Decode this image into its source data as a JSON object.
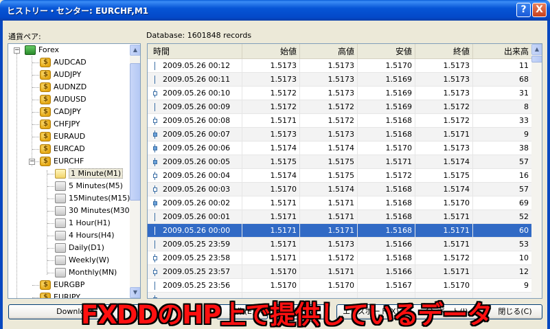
{
  "window": {
    "title": "ヒストリー・センター: EURCHF,M1",
    "help_label": "?",
    "close_label": "X"
  },
  "labels": {
    "currency_pair": "通貨ペア:",
    "database": "Database: 1601848 records"
  },
  "tree": {
    "root": "Forex",
    "pairs": [
      "AUDCAD",
      "AUDJPY",
      "AUDNZD",
      "AUDUSD",
      "CADJPY",
      "CHFJPY",
      "EURAUD",
      "EURCAD",
      "EURCHF"
    ],
    "timeframes": [
      "1 Minute(M1)",
      "5 Minutes(M5)",
      "15Minutes(M15)",
      "30 Minutes(M30)",
      "1 Hour(H1)",
      "4 Hours(H4)",
      "Daily(D1)",
      "Weekly(W)",
      "Monthly(MN)"
    ],
    "after": [
      "EURGBP",
      "EURJPY"
    ],
    "selected": "1 Minute(M1)"
  },
  "grid": {
    "columns": [
      "時間",
      "始値",
      "高値",
      "安値",
      "終値",
      "出来高"
    ],
    "rows": [
      {
        "time": "2009.05.26 00:12",
        "open": "1.5173",
        "high": "1.5173",
        "low": "1.5170",
        "close": "1.5173",
        "vol": "11",
        "candle": "doji"
      },
      {
        "time": "2009.05.26 00:11",
        "open": "1.5173",
        "high": "1.5173",
        "low": "1.5169",
        "close": "1.5173",
        "vol": "68",
        "candle": "doji"
      },
      {
        "time": "2009.05.26 00:10",
        "open": "1.5172",
        "high": "1.5173",
        "low": "1.5169",
        "close": "1.5173",
        "vol": "31",
        "candle": "hollow"
      },
      {
        "time": "2009.05.26 00:09",
        "open": "1.5172",
        "high": "1.5172",
        "low": "1.5169",
        "close": "1.5172",
        "vol": "8",
        "candle": "doji"
      },
      {
        "time": "2009.05.26 00:08",
        "open": "1.5171",
        "high": "1.5172",
        "low": "1.5168",
        "close": "1.5172",
        "vol": "33",
        "candle": "hollow"
      },
      {
        "time": "2009.05.26 00:07",
        "open": "1.5173",
        "high": "1.5173",
        "low": "1.5168",
        "close": "1.5171",
        "vol": "9",
        "candle": "filled"
      },
      {
        "time": "2009.05.26 00:06",
        "open": "1.5174",
        "high": "1.5174",
        "low": "1.5170",
        "close": "1.5173",
        "vol": "38",
        "candle": "filled"
      },
      {
        "time": "2009.05.26 00:05",
        "open": "1.5175",
        "high": "1.5175",
        "low": "1.5171",
        "close": "1.5174",
        "vol": "57",
        "candle": "filled"
      },
      {
        "time": "2009.05.26 00:04",
        "open": "1.5174",
        "high": "1.5175",
        "low": "1.5172",
        "close": "1.5175",
        "vol": "16",
        "candle": "hollow"
      },
      {
        "time": "2009.05.26 00:03",
        "open": "1.5170",
        "high": "1.5174",
        "low": "1.5168",
        "close": "1.5174",
        "vol": "57",
        "candle": "hollow"
      },
      {
        "time": "2009.05.26 00:02",
        "open": "1.5171",
        "high": "1.5171",
        "low": "1.5168",
        "close": "1.5170",
        "vol": "69",
        "candle": "filled"
      },
      {
        "time": "2009.05.26 00:01",
        "open": "1.5171",
        "high": "1.5171",
        "low": "1.5168",
        "close": "1.5171",
        "vol": "52",
        "candle": "doji"
      },
      {
        "time": "2009.05.26 00:00",
        "open": "1.5171",
        "high": "1.5171",
        "low": "1.5168",
        "close": "1.5171",
        "vol": "60",
        "candle": "doji"
      },
      {
        "time": "2009.05.25 23:59",
        "open": "1.5171",
        "high": "1.5173",
        "low": "1.5166",
        "close": "1.5171",
        "vol": "53",
        "candle": "doji"
      },
      {
        "time": "2009.05.25 23:58",
        "open": "1.5171",
        "high": "1.5172",
        "low": "1.5168",
        "close": "1.5172",
        "vol": "10",
        "candle": "hollow"
      },
      {
        "time": "2009.05.25 23:57",
        "open": "1.5170",
        "high": "1.5171",
        "low": "1.5166",
        "close": "1.5171",
        "vol": "12",
        "candle": "hollow"
      },
      {
        "time": "2009.05.25 23:56",
        "open": "1.5170",
        "high": "1.5170",
        "low": "1.5167",
        "close": "1.5170",
        "vol": "9",
        "candle": "doji"
      },
      {
        "time": "",
        "open": "",
        "high": "",
        "low": "",
        "close": "",
        "vol": "",
        "candle": "filled"
      }
    ],
    "selected_index": 12
  },
  "buttons": {
    "download": "Download",
    "edit": "編集(E)",
    "delete": "削除(D)",
    "export": "エクスポート(X)",
    "import": "インポート(I)",
    "close": "閉じる(C)"
  },
  "overlay_caption": "FXDDのHP上で提供しているデータ",
  "colors": {
    "title_bar": "#0655d6",
    "selection": "#316ac5",
    "overlay_text": "#ff1010"
  }
}
